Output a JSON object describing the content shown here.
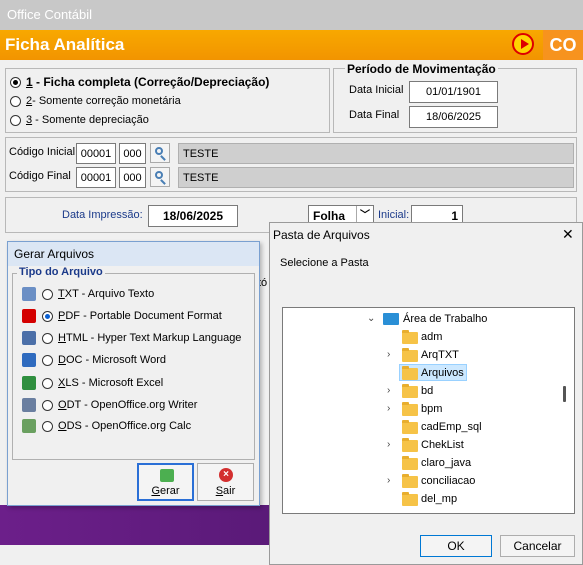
{
  "window": {
    "title": "Office Contábil"
  },
  "banner": {
    "title": "Ficha Analítica",
    "logo_text": "CO"
  },
  "options": [
    {
      "num": "1",
      "label": " - Ficha completa (Correção/Depreciação)",
      "selected": true
    },
    {
      "num": "2",
      "label": "- Somente correção monetária",
      "selected": false
    },
    {
      "num": "3",
      "label": " - Somente depreciação",
      "selected": false
    }
  ],
  "periodo": {
    "title": "Período de Movimentação",
    "inicial_label": "Data Inicial",
    "inicial_value": "01/01/1901",
    "final_label": "Data Final",
    "final_value": "18/06/2025"
  },
  "codigo": {
    "inicial_label": "Código Inicial",
    "inicial_a": "00001",
    "inicial_b": "000",
    "inicial_name": "TESTE",
    "final_label": "Código Final",
    "final_a": "00001",
    "final_b": "000",
    "final_name": "TESTE"
  },
  "impressao": {
    "label": "Data Impressão:",
    "value": "18/06/2025",
    "folha_value": "Folha",
    "inicial_label": "Inicial:",
    "inicial_value": "1"
  },
  "partial_text": "tó",
  "gerar": {
    "title": "Gerar Arquivos",
    "group_title": "Tipo do Arquivo",
    "types": [
      {
        "key": "T",
        "rest": "XT",
        "desc": " - Arquivo Texto",
        "bold": true,
        "selected": false,
        "icon": "text-file-icon",
        "color": "#6b8fc5"
      },
      {
        "key": "P",
        "rest": "DF",
        "desc": " - Portable Document Format",
        "bold": false,
        "selected": true,
        "icon": "pdf-icon",
        "color": "#d40000"
      },
      {
        "key": "H",
        "rest": "TML",
        "desc": " - Hyper Text Markup Language",
        "bold": false,
        "selected": false,
        "icon": "html-icon",
        "color": "#4b6fa8"
      },
      {
        "key": "D",
        "rest": "OC",
        "desc": " - Microsoft Word",
        "bold": false,
        "selected": false,
        "icon": "word-icon",
        "color": "#2f6bbf"
      },
      {
        "key": "X",
        "rest": "LS",
        "desc": " - Microsoft Excel",
        "bold": false,
        "selected": false,
        "icon": "excel-icon",
        "color": "#2f8f3f"
      },
      {
        "key": "O",
        "rest": "DT",
        "desc": " - OpenOffice.org Writer",
        "bold": false,
        "selected": false,
        "icon": "odt-icon",
        "color": "#6a7fa0"
      },
      {
        "key": "O",
        "rest": "DS",
        "desc": " - OpenOffice.org Calc",
        "bold": false,
        "selected": false,
        "icon": "ods-icon",
        "color": "#6aa060"
      }
    ],
    "btn_gerar_key": "G",
    "btn_gerar_rest": "erar",
    "btn_sair_key": "S",
    "btn_sair_rest": "air"
  },
  "dialog": {
    "title": "Pasta de Arquivos",
    "close": "✕",
    "prompt": "Selecione a Pasta",
    "root": "Área de Trabalho",
    "folders": [
      {
        "name": "adm",
        "expandable": false,
        "selected": false
      },
      {
        "name": "ArqTXT",
        "expandable": true,
        "selected": false
      },
      {
        "name": "Arquivos",
        "expandable": false,
        "selected": true
      },
      {
        "name": "bd",
        "expandable": true,
        "selected": false
      },
      {
        "name": "bpm",
        "expandable": true,
        "selected": false
      },
      {
        "name": "cadEmp_sql",
        "expandable": false,
        "selected": false
      },
      {
        "name": "ChekList",
        "expandable": true,
        "selected": false
      },
      {
        "name": "claro_java",
        "expandable": false,
        "selected": false
      },
      {
        "name": "conciliacao",
        "expandable": true,
        "selected": false
      },
      {
        "name": "del_mp",
        "expandable": false,
        "selected": false
      }
    ],
    "ok": "OK",
    "cancel": "Cancelar"
  }
}
